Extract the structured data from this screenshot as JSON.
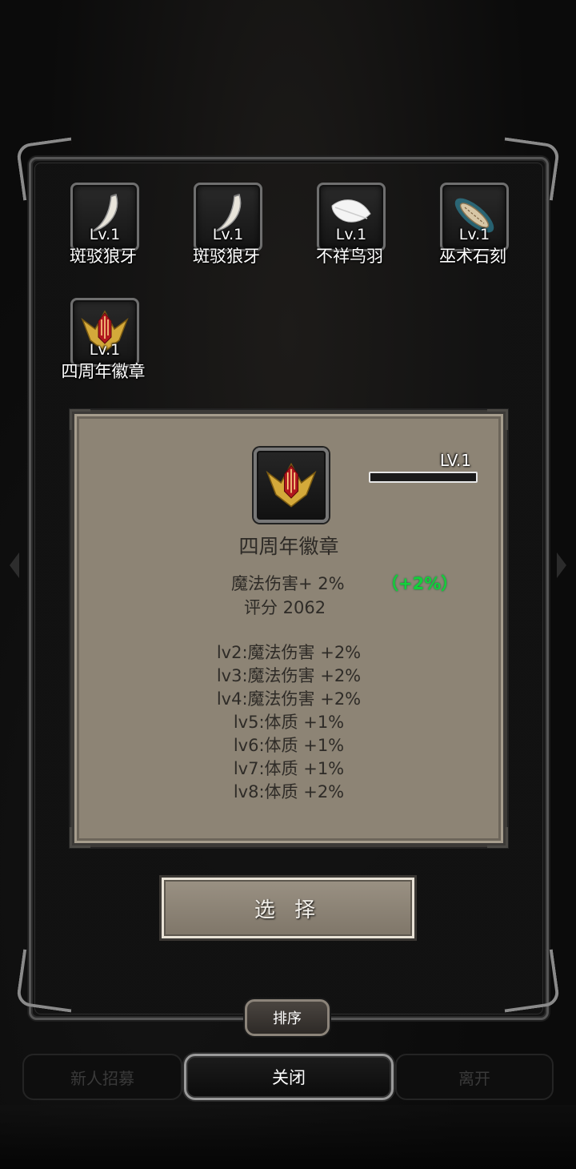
{
  "items": [
    {
      "level": "Lv.1",
      "name": "斑驳狼牙",
      "icon": "fang-icon"
    },
    {
      "level": "Lv.1",
      "name": "斑驳狼牙",
      "icon": "fang-icon"
    },
    {
      "level": "Lv.1",
      "name": "不祥鸟羽",
      "icon": "feather-icon"
    },
    {
      "level": "Lv.1",
      "name": "巫术石刻",
      "icon": "carved-stone-icon"
    },
    {
      "level": "Lv.1",
      "name": "四周年徽章",
      "icon": "badge-icon"
    }
  ],
  "detail": {
    "level": "LV.1",
    "xp_progress": 0,
    "name": "四周年徽章",
    "stat": "魔法伤害+ 2%",
    "stat_bonus": "（+2%）",
    "score": "评分 2062",
    "level_bonuses": [
      "lv2:魔法伤害 +2%",
      "lv3:魔法伤害 +2%",
      "lv4:魔法伤害 +2%",
      "lv5:体质 +1%",
      "lv6:体质 +1%",
      "lv7:体质 +1%",
      "lv8:体质 +2%"
    ]
  },
  "buttons": {
    "select": "选 择",
    "sort": "排序",
    "close": "关闭"
  },
  "bottom_tabs": {
    "left": "新人招募",
    "right": "离开"
  },
  "colors": {
    "panel_bg": "#8d8475",
    "bonus_green": "#13d13a"
  }
}
